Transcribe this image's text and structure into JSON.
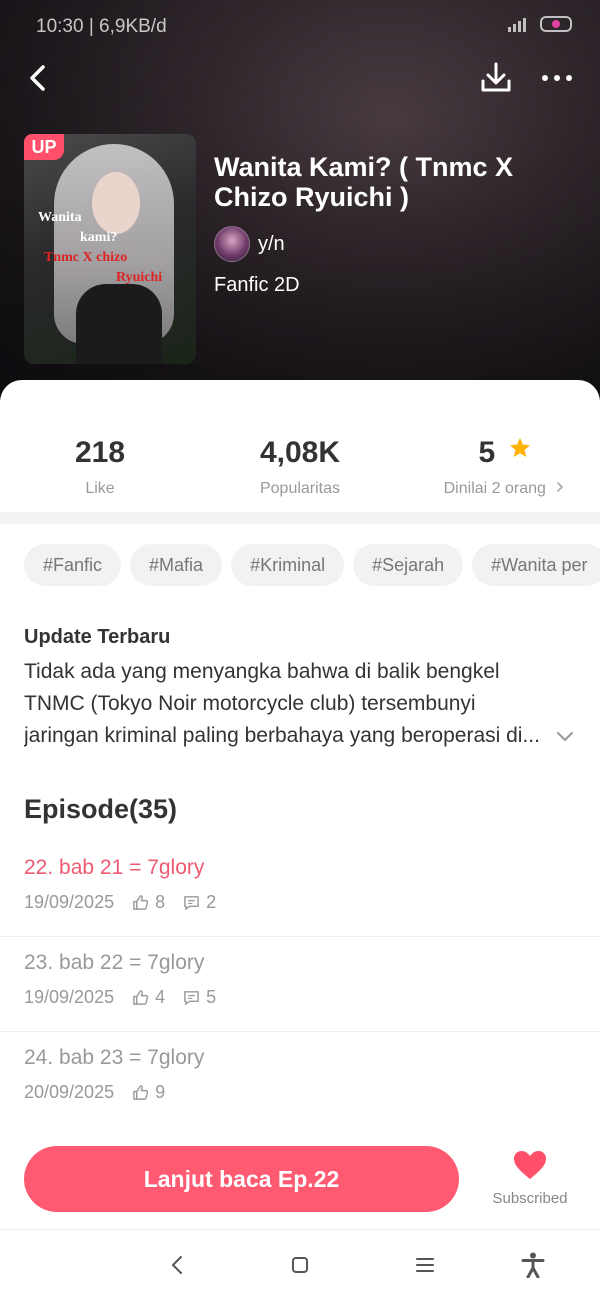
{
  "status_bar": {
    "time": "10:30 | 6,9KB/d"
  },
  "book": {
    "badge": "UP",
    "cover_text": [
      "Wanita",
      "kami?",
      "Tnmc X chizo",
      "Ryuichi"
    ],
    "title": "Wanita Kami? ( Tnmc X Chizo Ryuichi )",
    "author": "y/n",
    "genre": "Fanfic 2D"
  },
  "stats": {
    "likes": {
      "value": "218",
      "label": "Like"
    },
    "popularity": {
      "value": "4,08K",
      "label": "Popularitas"
    },
    "rating": {
      "value": "5",
      "label": "Dinilai 2 orang"
    }
  },
  "tags": [
    "#Fanfic",
    "#Mafia",
    "#Kriminal",
    "#Sejarah",
    "#Wanita per"
  ],
  "update": {
    "title": "Update Terbaru",
    "body": "Tidak ada yang menyangka bahwa di balik bengkel TNMC (Tokyo Noir motorcycle club) tersembunyi jaringan kriminal paling berbahaya yang beroperasi di..."
  },
  "episodes": {
    "header": "Episode(35)",
    "items": [
      {
        "title": "22. bab 21 = 7glory",
        "date": "19/09/2025",
        "likes": "8",
        "comments": "2",
        "current": true
      },
      {
        "title": "23. bab 22 = 7glory",
        "date": "19/09/2025",
        "likes": "4",
        "comments": "5",
        "current": false
      },
      {
        "title": "24. bab 23 = 7glory",
        "date": "20/09/2025",
        "likes": "9",
        "comments": null,
        "current": false
      }
    ]
  },
  "actions": {
    "continue_label": "Lanjut baca Ep.22",
    "subscribed_label": "Subscribed"
  },
  "colors": {
    "accent": "#ff5a72",
    "current_episode": "#ef5a72",
    "star": "#ffb300"
  },
  "icons": [
    "back-icon",
    "download-icon",
    "more-icon",
    "star-icon",
    "chevron-right-icon",
    "chevron-down-icon",
    "thumb-up-icon",
    "comment-icon",
    "heart-icon",
    "nav-back-icon",
    "nav-home-icon",
    "nav-menu-icon",
    "accessibility-icon"
  ]
}
